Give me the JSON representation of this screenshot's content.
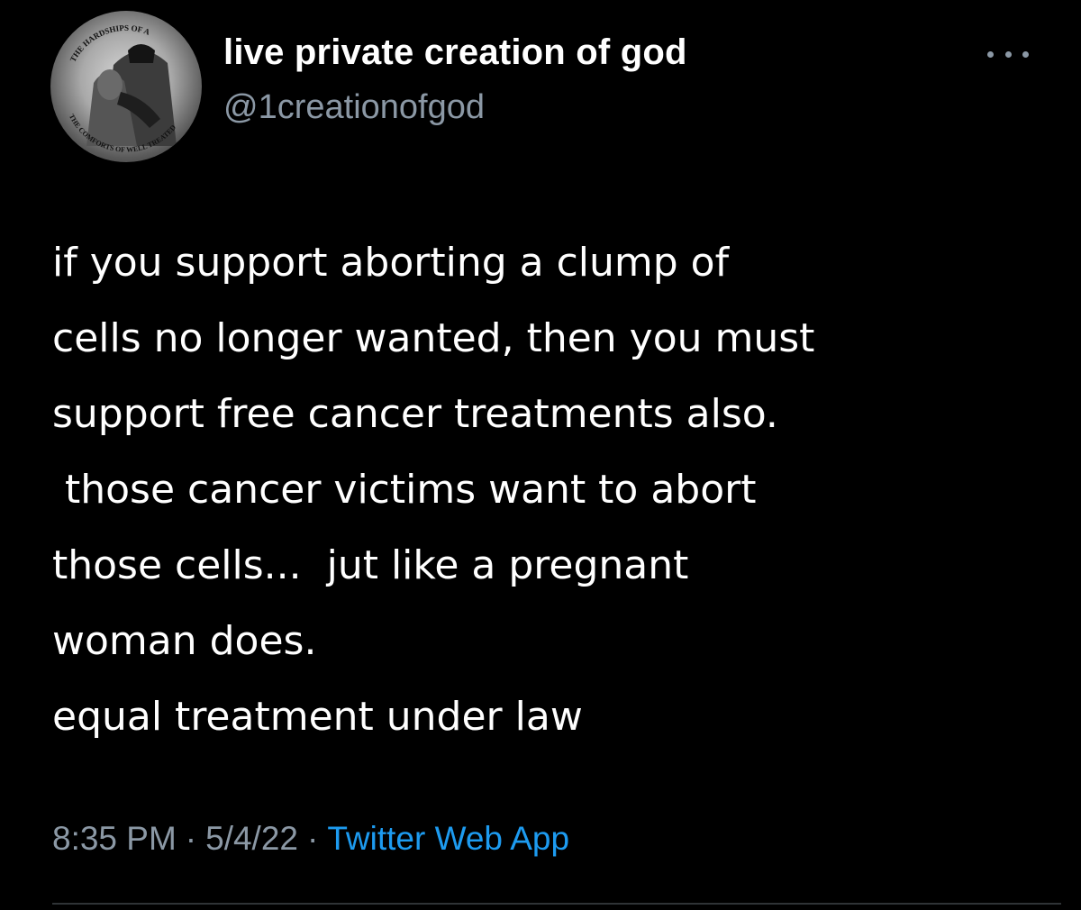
{
  "author": {
    "display_name": "live private creation of god",
    "handle": "@1creationofgod",
    "avatar_icon": "warrior-portrait-avatar",
    "avatar_caption_top": "THE HARDSHIPS OF A",
    "avatar_caption_bottom": "THE COMFORTS OF WELL TREATED"
  },
  "menu": {
    "more_icon": "ellipsis-icon"
  },
  "tweet": {
    "lines": [
      "if you support aborting a clump of",
      "cells no longer wanted, then you must",
      "support free cancer treatments also.",
      " those cancer victims want to abort",
      "those cells...  jut like a pregnant",
      "woman does.",
      "equal treatment under law"
    ]
  },
  "meta": {
    "time": "8:35 PM",
    "separator": "·",
    "date": "5/4/22",
    "source": "Twitter Web App"
  },
  "colors": {
    "background": "#000000",
    "text": "#ffffff",
    "secondary": "#8b98a5",
    "link": "#1d9bf0"
  }
}
